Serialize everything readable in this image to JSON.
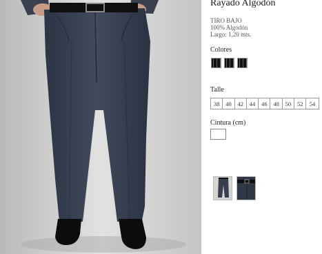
{
  "product": {
    "title": "Rayado Algodón",
    "specs": [
      "TIRO BAJO",
      "100% Algodón",
      "Largo: 1,20 mts."
    ]
  },
  "colors": {
    "label": "Colores",
    "swatches": [
      "black-pinstripe-1",
      "black-pinstripe-2",
      "black-pinstripe-3"
    ]
  },
  "sizes": {
    "label": "Talle",
    "options": [
      "38",
      "40",
      "42",
      "44",
      "46",
      "48",
      "50",
      "52",
      "54"
    ]
  },
  "waist": {
    "label": "Cintura (cm)",
    "value": ""
  },
  "thumbnails": [
    "front-view",
    "detail-view"
  ]
}
